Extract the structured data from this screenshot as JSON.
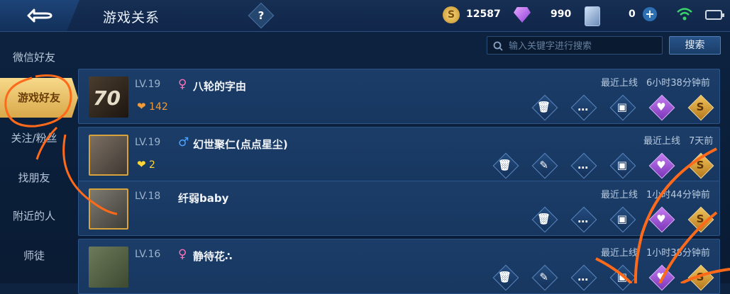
{
  "header": {
    "title": "游戏关系",
    "help_label": "?",
    "coins": "12587",
    "gems": "990",
    "cards": "0",
    "plus_label": "+"
  },
  "sidebar": {
    "items": [
      {
        "label": "微信好友"
      },
      {
        "label": "游戏好友"
      },
      {
        "label": "关注/粉丝"
      },
      {
        "label": "找朋友"
      },
      {
        "label": "附近的人"
      },
      {
        "label": "师徒"
      }
    ],
    "active_index": 1
  },
  "search": {
    "placeholder": "输入关键字进行搜索",
    "button_label": "搜索"
  },
  "friends": [
    {
      "level": "LV.19",
      "gender": "♀",
      "name": "八轮的字由",
      "intimacy": "142",
      "last_label": "最近上线",
      "last_time": "6小时38分钟前"
    },
    {
      "level": "LV.19",
      "gender": "♂",
      "name": "幻世聚仁(点点星尘)",
      "intimacy": "2",
      "last_label": "最近上线",
      "last_time": "7天前"
    },
    {
      "level": "LV.18",
      "gender": "",
      "name": "纤弱baby",
      "intimacy": "",
      "last_label": "最近上线",
      "last_time": "1小时44分钟前"
    },
    {
      "level": "LV.16",
      "gender": "♀",
      "name": "静待花∴",
      "intimacy": "",
      "last_label": "最近上线",
      "last_time": "1小时38分钟前"
    }
  ],
  "icons": {
    "delete": "trash-icon",
    "mentor": "mentor-icon",
    "chat": "chat-icon",
    "gift": "gift-icon",
    "intimacy": "heart-card-icon",
    "coin": "coin-icon"
  },
  "colors": {
    "accent_gold": "#d9a84a",
    "female": "#ff6fb4",
    "male": "#4ea3ff",
    "annotation": "#ff6a1a"
  }
}
